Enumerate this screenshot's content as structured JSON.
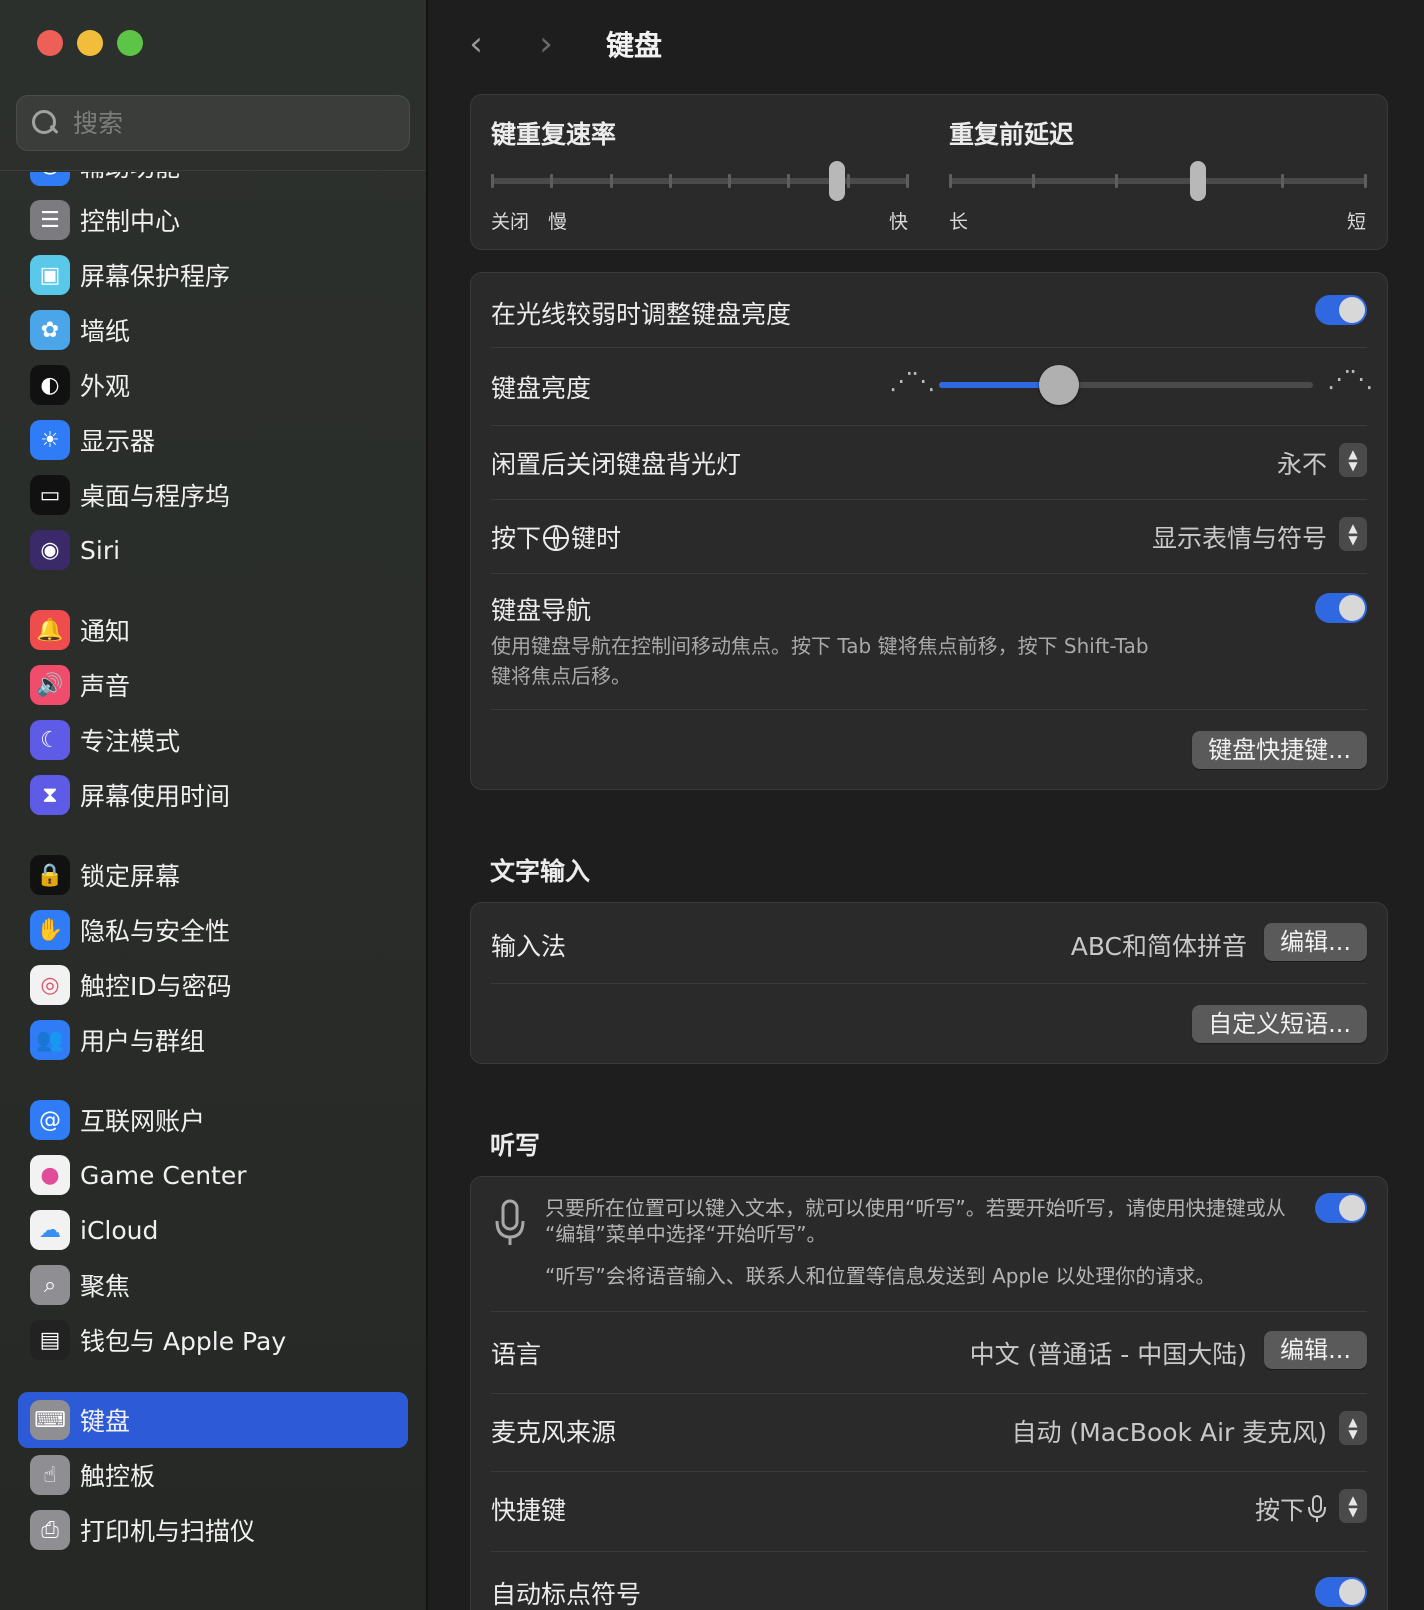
{
  "sidebar": {
    "search_placeholder": "搜索",
    "partial_item": "辅助功能",
    "items": [
      {
        "label": "控制中心",
        "icon": "control-center-icon",
        "color": "#7c7c80"
      },
      {
        "label": "屏幕保护程序",
        "icon": "screensaver-icon",
        "color": "#5ac8e8"
      },
      {
        "label": "墙纸",
        "icon": "wallpaper-icon",
        "color": "#4aa6e8"
      },
      {
        "label": "外观",
        "icon": "appearance-icon",
        "color": "#111111"
      },
      {
        "label": "显示器",
        "icon": "display-icon",
        "color": "#2f7cf6"
      },
      {
        "label": "桌面与程序坞",
        "icon": "dock-icon",
        "color": "#111111"
      },
      {
        "label": "Siri",
        "icon": "siri-icon",
        "color": "#3a2a6a"
      },
      {
        "label": "通知",
        "icon": "notifications-icon",
        "color": "#ef4d4d"
      },
      {
        "label": "声音",
        "icon": "sound-icon",
        "color": "#ef4d6b"
      },
      {
        "label": "专注模式",
        "icon": "focus-icon",
        "color": "#5e5ce6"
      },
      {
        "label": "屏幕使用时间",
        "icon": "screen-time-icon",
        "color": "#5e5ce6"
      },
      {
        "label": "锁定屏幕",
        "icon": "lock-screen-icon",
        "color": "#111111"
      },
      {
        "label": "隐私与安全性",
        "icon": "privacy-hand-icon",
        "color": "#2f7cf6"
      },
      {
        "label": "触控ID与密码",
        "icon": "touch-id-icon",
        "color": "#f2f2f2"
      },
      {
        "label": "用户与群组",
        "icon": "users-icon",
        "color": "#2f7cf6"
      },
      {
        "label": "互联网账户",
        "icon": "internet-accounts-icon",
        "color": "#2f7cf6"
      },
      {
        "label": "Game Center",
        "icon": "game-center-icon",
        "color": "#f2f2f2"
      },
      {
        "label": "iCloud",
        "icon": "icloud-icon",
        "color": "#f2f2f2"
      },
      {
        "label": "聚焦",
        "icon": "spotlight-icon",
        "color": "#8e8e93"
      },
      {
        "label": "钱包与 Apple Pay",
        "icon": "wallet-icon",
        "color": "#222222"
      },
      {
        "label": "键盘",
        "icon": "keyboard-icon",
        "color": "#8e8e93"
      },
      {
        "label": "触控板",
        "icon": "trackpad-icon",
        "color": "#8e8e93"
      },
      {
        "label": "打印机与扫描仪",
        "icon": "printer-icon",
        "color": "#8e8e93"
      }
    ],
    "active_label": "键盘"
  },
  "header": {
    "title": "键盘"
  },
  "repeat": {
    "rate_label": "键重复速率",
    "rate_caps": [
      "关闭",
      "慢",
      "快"
    ],
    "rate_level": 0.84,
    "delay_label": "重复前延迟",
    "delay_caps": [
      "长",
      "短"
    ],
    "delay_level": 0.6
  },
  "keyboard": {
    "auto_brightness_label": "在光线较弱时调整键盘亮度",
    "brightness_label": "键盘亮度",
    "brightness_level": 0.3,
    "backlight_off_label": "闲置后关闭键盘背光灯",
    "backlight_off_value": "永不",
    "globe_label_prefix": "按下",
    "globe_label_suffix": "键时",
    "globe_value": "显示表情与符号",
    "nav_label": "键盘导航",
    "nav_desc_1": "使用键盘导航在控制间移动焦点。按下 Tab 键将焦点前移，按下 Shift-Tab",
    "nav_desc_2": "键将焦点后移。",
    "shortcuts_button": "键盘快捷键..."
  },
  "text_input": {
    "section": "文字输入",
    "input_label": "输入法",
    "input_value": "ABC和简体拼音",
    "edit_button": "编辑...",
    "replacements_button": "自定义短语..."
  },
  "dictation": {
    "section": "听写",
    "desc_1": "只要所在位置可以键入文本，就可以使用“听写”。若要开始听写，请使用快捷键或从",
    "desc_2": "“编辑”菜单中选择“开始听写”。",
    "desc_3": "“听写”会将语音输入、联系人和位置等信息发送到 Apple 以处理你的请求。",
    "language_label": "语言",
    "language_value": "中文 (普通话 - 中国大陆)",
    "edit_button": "编辑...",
    "mic_label": "麦克风来源",
    "mic_value": "自动 (MacBook Air 麦克风)",
    "shortcut_label": "快捷键",
    "shortcut_value": "按下",
    "auto_punct_label": "自动标点符号"
  },
  "colors": {
    "accent": "#2f68e0",
    "active_sidebar": "#2d5bd8"
  }
}
